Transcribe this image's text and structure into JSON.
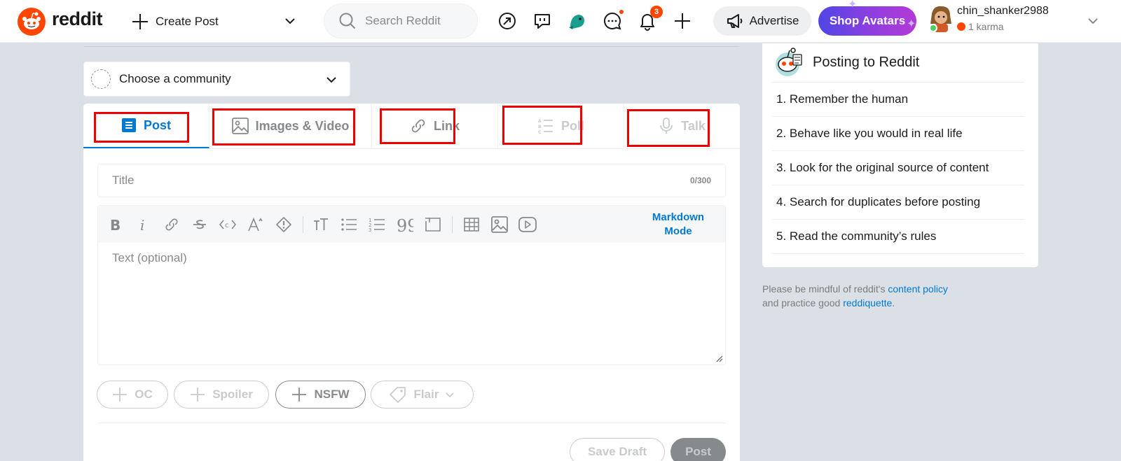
{
  "header": {
    "wordmark": "reddit",
    "create_post": "Create Post",
    "search_placeholder": "Search Reddit",
    "notification_count": "3",
    "advertise": "Advertise",
    "shop_avatars": "Shop Avatars",
    "username": "chin_shanker2988",
    "karma": "1 karma"
  },
  "community": {
    "placeholder": "Choose a community"
  },
  "tabs": [
    {
      "label": "Post",
      "state": "active"
    },
    {
      "label": "Images & Video",
      "state": "enabled"
    },
    {
      "label": "Link",
      "state": "enabled"
    },
    {
      "label": "Poll",
      "state": "disabled"
    },
    {
      "label": "Talk",
      "state": "disabled"
    }
  ],
  "composer": {
    "title_placeholder": "Title",
    "title_count": "0/300",
    "markdown_mode": "Markdown Mode",
    "text_placeholder": "Text (optional)",
    "tags": {
      "oc": "OC",
      "spoiler": "Spoiler",
      "nsfw": "NSFW",
      "flair": "Flair"
    },
    "save_draft": "Save Draft",
    "post": "Post"
  },
  "sidebar": {
    "rules_title": "Posting to Reddit",
    "rules": [
      "1. Remember the human",
      "2. Behave like you would in real life",
      "3. Look for the original source of content",
      "4. Search for duplicates before posting",
      "5. Read the community’s rules"
    ],
    "policy_prefix": "Please be mindful of reddit's ",
    "policy_link": "content policy",
    "policy_mid": "and practice good ",
    "reddiquette_link": "reddiquette",
    "policy_suffix": "."
  },
  "colors": {
    "brand": "#ff4500",
    "accent": "#0079d3",
    "highlight_box": "#ee0000",
    "background": "#dae0e6"
  }
}
